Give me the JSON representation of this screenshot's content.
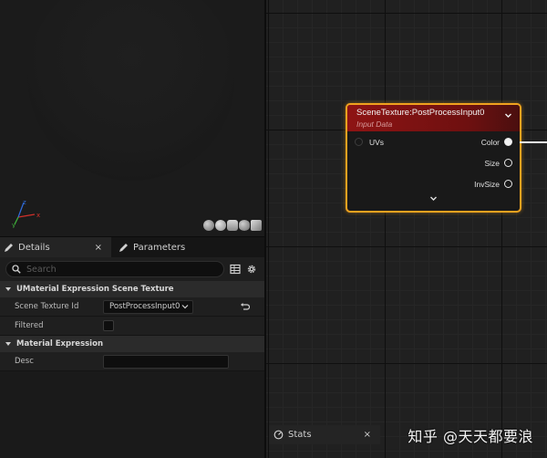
{
  "details": {
    "tabs": [
      {
        "label": "Details",
        "icon": "pencil-icon",
        "close": "×"
      },
      {
        "label": "Parameters",
        "icon": "pencil-icon"
      }
    ],
    "search_placeholder": "Search",
    "sections": [
      {
        "title": "UMaterial Expression Scene Texture"
      },
      {
        "title": "Material Expression"
      }
    ],
    "properties": {
      "scene_texture_id": {
        "label": "Scene Texture Id",
        "value": "PostProcessInput0"
      },
      "filtered": {
        "label": "Filtered",
        "checked": false
      },
      "desc": {
        "label": "Desc",
        "value": ""
      }
    }
  },
  "node": {
    "title": "SceneTexture:PostProcessInput0",
    "subtitle": "Input Data",
    "inputs": [
      {
        "label": "UVs"
      }
    ],
    "outputs": [
      {
        "label": "Color"
      },
      {
        "label": "Size"
      },
      {
        "label": "InvSize"
      }
    ],
    "header_color": "#8e1414",
    "border_color": "#f0a21f"
  },
  "stats_tab": {
    "label": "Stats",
    "close": "×"
  },
  "watermark": "知乎 @天天都要浪"
}
